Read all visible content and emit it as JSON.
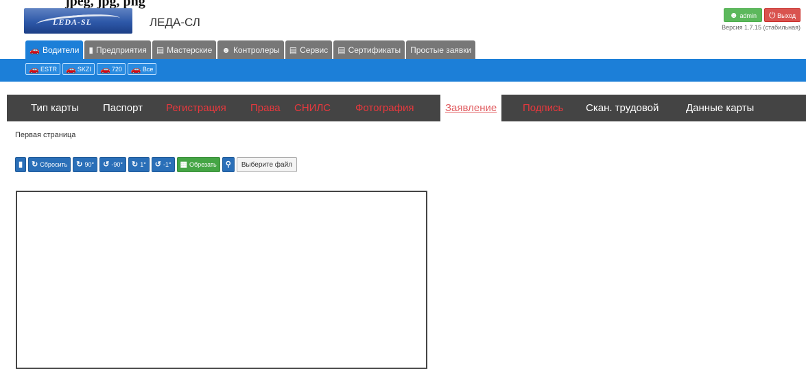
{
  "top_caption": "jpeg, jpg, png",
  "logo_text": "LEDA-SL",
  "app_title": "ЛЕДА-СЛ",
  "user": {
    "admin_label": "admin",
    "exit_label": "Выход",
    "version": "Версия 1.7.15 (стабильная)"
  },
  "main_tabs": [
    {
      "label": "Водители",
      "icon": "car-icon"
    },
    {
      "label": "Предприятия",
      "icon": "building-icon"
    },
    {
      "label": "Мастерские",
      "icon": "workshop-icon"
    },
    {
      "label": "Контролеры",
      "icon": "controller-icon"
    },
    {
      "label": "Сервис",
      "icon": "service-icon"
    },
    {
      "label": "Сертификаты",
      "icon": "certificate-icon"
    },
    {
      "label": "Простые заявки",
      "icon": ""
    }
  ],
  "sub_tabs": [
    {
      "label": "ESTR",
      "icon": "car-icon"
    },
    {
      "label": "SKZI",
      "icon": "car-icon"
    },
    {
      "label": "720",
      "icon": "car-icon"
    },
    {
      "label": "Все",
      "icon": "car-icon"
    }
  ],
  "card_tabs": [
    {
      "label": "Тип карты",
      "status": "normal"
    },
    {
      "label": "Паспорт",
      "status": "normal"
    },
    {
      "label": "Регистрация",
      "status": "error"
    },
    {
      "label": "Права",
      "status": "error"
    },
    {
      "label": "СНИЛС",
      "status": "error"
    },
    {
      "label": "Фотография",
      "status": "error"
    },
    {
      "label": "Заявление",
      "status": "active"
    },
    {
      "label": "Подпись",
      "status": "error"
    },
    {
      "label": "Скан. трудовой",
      "status": "normal"
    },
    {
      "label": "Данные карты",
      "status": "normal"
    }
  ],
  "page_label": "Первая страница",
  "toolbar": {
    "reset_label": "Сбросить",
    "rotate_cw_90_label": "90°",
    "rotate_ccw_90_label": "-90°",
    "rotate_cw_1_label": "1°",
    "rotate_ccw_1_label": "-1°",
    "crop_label": "Обрезать",
    "choose_file_label": "Выберите файл"
  },
  "colors": {
    "primary_blue": "#1c7fd8",
    "tab_gray": "#777777",
    "dark_bar": "#444444",
    "error_red": "#e8383d",
    "green": "#45a545"
  }
}
